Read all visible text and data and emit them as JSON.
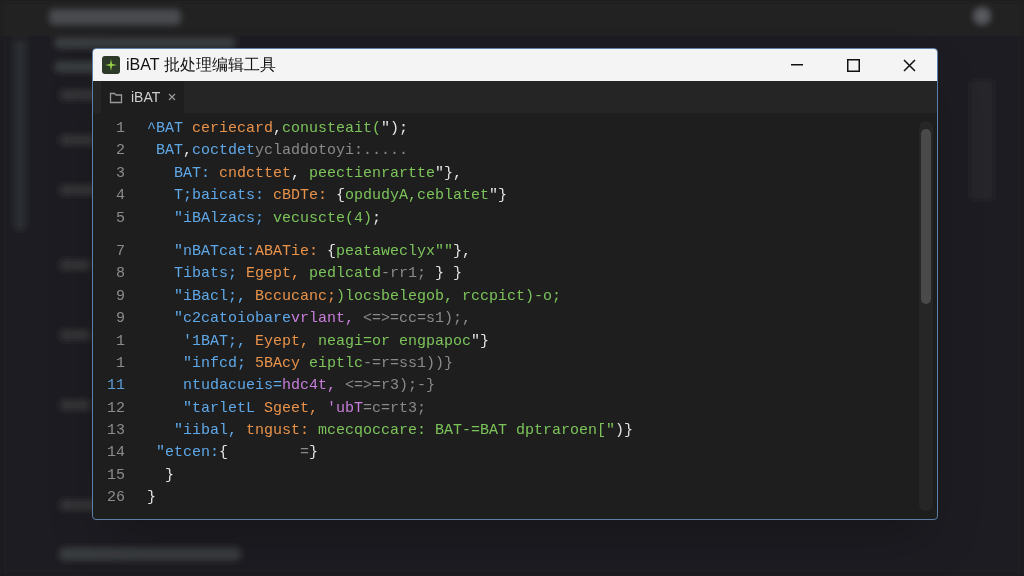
{
  "window": {
    "title": "iBAT 批处理编辑工具"
  },
  "tabs": [
    {
      "label": "iBAT",
      "selected": true
    }
  ],
  "editor": {
    "lines": [
      {
        "kind": "code",
        "number": "1",
        "current": false,
        "tokens": [
          {
            "text": "^BAT",
            "kind": "keyword"
          },
          {
            "text": " ceriecard",
            "kind": "name"
          },
          {
            "text": ",",
            "kind": "punct"
          },
          {
            "text": "conusteait(",
            "kind": "string"
          },
          {
            "text": "\");",
            "kind": "punct"
          }
        ]
      },
      {
        "kind": "code",
        "number": "2",
        "current": false,
        "tokens": [
          {
            "text": " BAT",
            "kind": "keyword"
          },
          {
            "text": ",",
            "kind": "punct"
          },
          {
            "text": "coctdet",
            "kind": "keyword"
          },
          {
            "text": "ycladdotoyi:.....",
            "kind": "faded"
          }
        ]
      },
      {
        "kind": "code",
        "number": "3",
        "current": false,
        "tokens": [
          {
            "text": "   BAT:",
            "kind": "keyword"
          },
          {
            "text": " cndcttet",
            "kind": "name"
          },
          {
            "text": ",",
            "kind": "punct"
          },
          {
            "text": " peectienrartte",
            "kind": "string"
          },
          {
            "text": "\"},",
            "kind": "punct"
          }
        ]
      },
      {
        "kind": "code",
        "number": "4",
        "current": false,
        "tokens": [
          {
            "text": "   T;baicats:",
            "kind": "keyword"
          },
          {
            "text": " cBDTe:",
            "kind": "name"
          },
          {
            "text": " {",
            "kind": "punct"
          },
          {
            "text": "opdudyA,ceblatet",
            "kind": "string"
          },
          {
            "text": "\"}",
            "kind": "punct"
          }
        ]
      },
      {
        "kind": "code",
        "number": "5",
        "current": false,
        "tokens": [
          {
            "text": "   \"iBAlzacs;",
            "kind": "keyword"
          },
          {
            "text": " vecuscte(4)",
            "kind": "string"
          },
          {
            "text": ";",
            "kind": "punct"
          }
        ]
      },
      {
        "kind": "blank"
      },
      {
        "kind": "code",
        "number": "7",
        "current": false,
        "tokens": [
          {
            "text": "   \"nBATcat:",
            "kind": "keyword"
          },
          {
            "text": "ABATie:",
            "kind": "name"
          },
          {
            "text": " {",
            "kind": "punct"
          },
          {
            "text": "peataweclyx\"\"",
            "kind": "string"
          },
          {
            "text": "},",
            "kind": "punct"
          }
        ]
      },
      {
        "kind": "code",
        "number": "8",
        "current": false,
        "tokens": [
          {
            "text": "   Tibats;",
            "kind": "keyword"
          },
          {
            "text": " Egept,",
            "kind": "name"
          },
          {
            "text": " pedlcatd",
            "kind": "string"
          },
          {
            "text": "-rr1;",
            "kind": "faded"
          },
          {
            "text": " } }",
            "kind": "punct"
          }
        ]
      },
      {
        "kind": "code",
        "number": "9",
        "current": false,
        "tokens": [
          {
            "text": "   \"iBacl;,",
            "kind": "keyword"
          },
          {
            "text": " Bccucanc;",
            "kind": "name"
          },
          {
            "text": ")locsbelegob, rccpict)-o;",
            "kind": "string"
          }
        ]
      },
      {
        "kind": "code",
        "number": "9",
        "current": false,
        "tokens": [
          {
            "text": "   \"c2catoiobare",
            "kind": "keyword"
          },
          {
            "text": "vrlant,",
            "kind": "value"
          },
          {
            "text": " <=>=cc=s1);,",
            "kind": "faded"
          }
        ]
      },
      {
        "kind": "code",
        "number": "1",
        "current": false,
        "tokens": [
          {
            "text": "    '1BAT;,",
            "kind": "keyword"
          },
          {
            "text": " Eyept,",
            "kind": "name"
          },
          {
            "text": " neagi=or engpapoc",
            "kind": "string"
          },
          {
            "text": "\"}",
            "kind": "punct"
          }
        ]
      },
      {
        "kind": "code",
        "number": "1",
        "current": false,
        "tokens": [
          {
            "text": "    \"infcd;",
            "kind": "keyword"
          },
          {
            "text": " 5BAcy",
            "kind": "name"
          },
          {
            "text": " eiptlc",
            "kind": "string"
          },
          {
            "text": "-=r=ss1))}",
            "kind": "faded"
          }
        ]
      },
      {
        "kind": "code",
        "number": "11",
        "current": true,
        "tokens": [
          {
            "text": "    ntudacueis=",
            "kind": "keyword"
          },
          {
            "text": "hdc4t,",
            "kind": "value"
          },
          {
            "text": " <=>=r3);-}",
            "kind": "faded"
          }
        ]
      },
      {
        "kind": "code",
        "number": "12",
        "current": false,
        "tokens": [
          {
            "text": "    \"tarletL",
            "kind": "keyword"
          },
          {
            "text": " Sgeet,",
            "kind": "name"
          },
          {
            "text": " 'ubT",
            "kind": "value"
          },
          {
            "text": "=c=rt3;",
            "kind": "faded"
          }
        ]
      },
      {
        "kind": "code",
        "number": "13",
        "current": false,
        "tokens": [
          {
            "text": "   \"iibal,",
            "kind": "keyword"
          },
          {
            "text": " tngust:",
            "kind": "name"
          },
          {
            "text": " mcecqoccare: BAT-=BAT dptraroen[\"",
            "kind": "string"
          },
          {
            "text": ")}",
            "kind": "punct"
          }
        ]
      },
      {
        "kind": "code",
        "number": "14",
        "current": false,
        "tokens": [
          {
            "text": " \"etcen:",
            "kind": "keyword"
          },
          {
            "text": "{",
            "kind": "punct"
          },
          {
            "text": "        =",
            "kind": "faded"
          },
          {
            "text": "}",
            "kind": "punct"
          }
        ]
      },
      {
        "kind": "code",
        "number": "15",
        "current": false,
        "tokens": [
          {
            "text": "  }",
            "kind": "punct"
          }
        ]
      },
      {
        "kind": "code",
        "number": "26",
        "current": false,
        "tokens": [
          {
            "text": "}",
            "kind": "punct"
          }
        ]
      }
    ]
  }
}
